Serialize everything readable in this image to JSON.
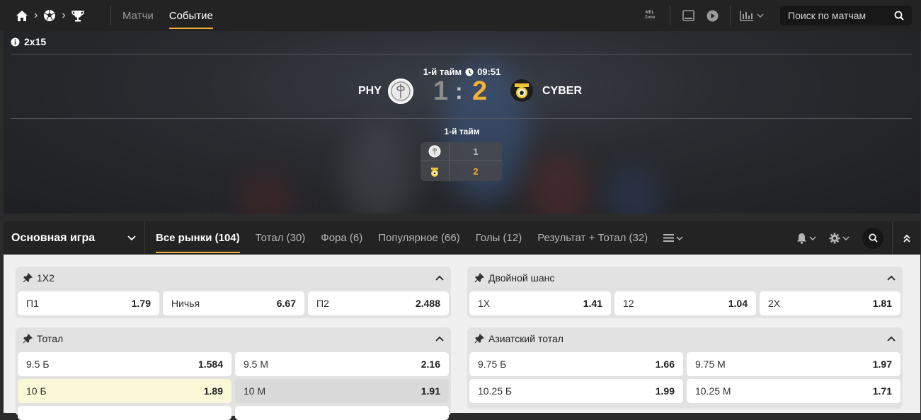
{
  "nav": {
    "icons": [
      "home-icon",
      "soccer-ball-icon",
      "trophy-icon"
    ],
    "tabs": [
      {
        "label": "Матчи",
        "active": false
      },
      {
        "label": "Событие",
        "active": true
      }
    ],
    "mel_zone": [
      "MEL",
      "Zone"
    ],
    "search_placeholder": "Поиск по матчам"
  },
  "event": {
    "format": "2x15",
    "period": "1-й тайм",
    "clock": "09:51",
    "home": {
      "name": "PHY",
      "score": "1"
    },
    "away": {
      "name": "CYBER",
      "score": "2"
    },
    "separator": ":",
    "period_table": {
      "title": "1-й тайм",
      "home_score": "1",
      "away_score": "2"
    }
  },
  "markets_bar": {
    "selector": "Основная игра",
    "tabs": [
      {
        "label": "Все рынки (104)",
        "active": true
      },
      {
        "label": "Тотал (30)",
        "active": false
      },
      {
        "label": "Фора (6)",
        "active": false
      },
      {
        "label": "Популярное (66)",
        "active": false
      },
      {
        "label": "Голы (12)",
        "active": false
      },
      {
        "label": "Результат + Тотал (32)",
        "active": false
      }
    ]
  },
  "groups": {
    "g1x2": {
      "title": "1X2",
      "odds": [
        {
          "label": "П1",
          "value": "1.79"
        },
        {
          "label": "Ничья",
          "value": "6.67"
        },
        {
          "label": "П2",
          "value": "2.488"
        }
      ]
    },
    "double": {
      "title": "Двойной шанс",
      "odds": [
        {
          "label": "1X",
          "value": "1.41"
        },
        {
          "label": "12",
          "value": "1.04"
        },
        {
          "label": "2X",
          "value": "1.81"
        }
      ]
    },
    "total": {
      "title": "Тотал",
      "odds": [
        {
          "label": "9.5 Б",
          "value": "1.584"
        },
        {
          "label": "9.5 М",
          "value": "2.16"
        },
        {
          "label": "10 Б",
          "value": "1.89"
        },
        {
          "label": "10 М",
          "value": "1.91"
        }
      ]
    },
    "asian": {
      "title": "Азиатский тотал",
      "odds": [
        {
          "label": "9.75 Б",
          "value": "1.66"
        },
        {
          "label": "9.75 М",
          "value": "1.97"
        },
        {
          "label": "10.25 Б",
          "value": "1.99"
        },
        {
          "label": "10.25 М",
          "value": "1.71"
        }
      ]
    }
  },
  "colors": {
    "accent": "#f2b134",
    "topbar": "#232323",
    "content_bg": "#f0f0f0"
  }
}
